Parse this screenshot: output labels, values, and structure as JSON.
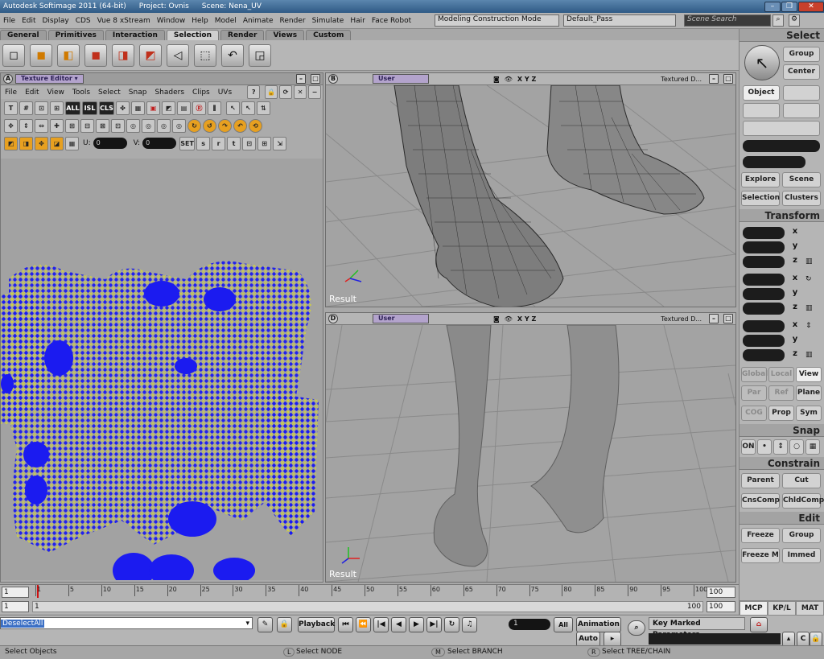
{
  "app": {
    "title": "Autodesk Softimage 2011 (64-bit)",
    "project": "Project: Ovnis",
    "scene": "Scene: Nena_UV"
  },
  "menubar": {
    "items": [
      "File",
      "Edit",
      "Display",
      "CDS",
      "Vue 8 xStream",
      "Window",
      "Help",
      "Model",
      "Animate",
      "Render",
      "Simulate",
      "Hair",
      "Face Robot"
    ],
    "mode": "Modeling Construction Mode",
    "pass": "Default_Pass",
    "search_placeholder": "Scene Search"
  },
  "tabs": [
    "General",
    "Primitives",
    "Interaction",
    "Selection",
    "Render",
    "Views",
    "Custom"
  ],
  "active_tab": "Selection",
  "texture_editor": {
    "label": "A",
    "title": "Texture Editor",
    "menu": [
      "File",
      "Edit",
      "View",
      "Tools",
      "Select",
      "Snap",
      "Shaders",
      "Clips",
      "UVs"
    ],
    "help_icon": "?",
    "tools_row1": [
      "T",
      "#",
      "⊡",
      "⊞",
      "ALL",
      "ISL",
      "CLS",
      "✤",
      "▦",
      "▣",
      "◩",
      "▤",
      "Ⓡ",
      "⫼"
    ],
    "u_label": "U:",
    "u_value": "0",
    "v_label": "V:",
    "v_value": "0",
    "set_label": "SET",
    "s_label": "s",
    "r_label": "r",
    "t_label": "t"
  },
  "viewports": [
    {
      "label": "B",
      "camera": "User",
      "axes": "X Y Z",
      "mode": "Textured D...",
      "result": "Result"
    },
    {
      "label": "D",
      "camera": "User",
      "axes": "X Y Z",
      "mode": "Textured D...",
      "result": "Result"
    }
  ],
  "right_panel": {
    "select_title": "Select",
    "group": "Group",
    "center": "Center",
    "object": "Object",
    "explore": "Explore",
    "scene": "Scene",
    "selection": "Selection",
    "clusters": "Clusters",
    "transform_title": "Transform",
    "axis_x": "x",
    "axis_y": "y",
    "axis_z": "z",
    "global": "Global",
    "local": "Local",
    "view": "View",
    "par": "Par",
    "ref": "Ref",
    "plane": "Plane",
    "cog": "COG",
    "prop": "Prop",
    "sym": "Sym",
    "snap_title": "Snap",
    "snap_on": "ON",
    "constrain_title": "Constrain",
    "parent": "Parent",
    "cut": "Cut",
    "cnscomp": "CnsComp",
    "chldcomp": "ChldComp",
    "edit_title": "Edit",
    "freeze": "Freeze",
    "group2": "Group",
    "freeze_m": "Freeze M",
    "immed": "Immed",
    "tabs": [
      "MCP",
      "KP/L",
      "MAT"
    ]
  },
  "timeline": {
    "start": "1",
    "end": "100",
    "current": "1",
    "range_end": "100",
    "ticks": [
      "1",
      "5",
      "10",
      "15",
      "20",
      "25",
      "30",
      "35",
      "40",
      "45",
      "50",
      "55",
      "60",
      "65",
      "70",
      "75",
      "80",
      "85",
      "90",
      "95",
      "100"
    ],
    "range_left": "1",
    "range_right": "100"
  },
  "playbar": {
    "command": "DeselectAll",
    "playback": "Playback",
    "frame": "1",
    "all": "All",
    "animation": "Animation",
    "auto": "Auto",
    "key_marked": "Key Marked Parameters"
  },
  "status": {
    "left": "Select Objects",
    "l_key": "L",
    "l_text": "Select NODE",
    "m_key": "M",
    "m_text": "Select BRANCH",
    "r_key": "R",
    "r_text": "Select TREE/CHAIN"
  },
  "colors": {
    "accent": "#2b5c8f",
    "uv_points": "#1b1bf0",
    "uv_edges": "#e0e020",
    "command_highlight": "#3b6fc4"
  }
}
